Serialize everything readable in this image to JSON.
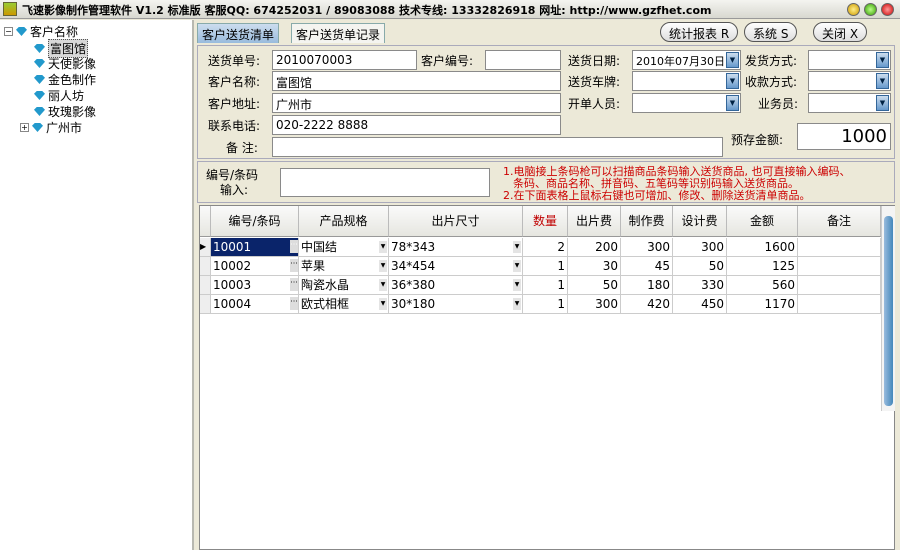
{
  "title": "飞速影像制作管理软件 V1.2 标准版 客服QQ: 674252031 / 89083088  技术专线: 13332826918 网址: http://www.gzfhet.com",
  "tree": {
    "root": "客户名称",
    "items": [
      "富图馆",
      "天使影像",
      "金色制作",
      "丽人坊",
      "玫瑰影像",
      "广州市"
    ]
  },
  "tabs": [
    "客户送货清单",
    "客户送货单记录"
  ],
  "buttons": {
    "report": "统计报表 R",
    "system": "系统 S",
    "close": "关闭 X"
  },
  "form": {
    "order_no_label": "送货单号:",
    "order_no": "2010070003",
    "cust_no_label": "客户编号:",
    "cust_no": "",
    "cust_name_label": "客户名称:",
    "cust_name": "富图馆",
    "address_label": "客户地址:",
    "address": "广州市",
    "phone_label": "联系电话:",
    "phone": "020-2222 8888",
    "note_label": "备  注:",
    "note": "",
    "date_label": "送货日期:",
    "date": "2010年07月30日",
    "plate_label": "送货车牌:",
    "plate": "",
    "issuer_label": "开单人员:",
    "issuer": "",
    "ship_label": "发货方式:",
    "ship": "",
    "pay_label": "收款方式:",
    "pay": "",
    "sales_label": "业务员:",
    "sales": "",
    "deposit_label": "预存金额:",
    "deposit": "1000"
  },
  "barcode": {
    "label1": "编号/条码",
    "label2": "输入:",
    "value": "",
    "hint1": "1.电脑接上条码枪可以扫描商品条码输入送货商品, 也可直接输入编码、",
    "hint2": "条码、商品名称、拼音码、五笔码等识别码输入送货商品。",
    "hint3": "2.在下面表格上鼠标右键也可增加、修改、删除送货清单商品。"
  },
  "grid": {
    "columns": [
      "编号/条码",
      "产品规格",
      "出片尺寸",
      "数量",
      "出片费",
      "制作费",
      "设计费",
      "金额",
      "备注"
    ],
    "rows": [
      [
        "10001",
        "中国结",
        "78*343",
        "2",
        "200",
        "300",
        "300",
        "1600",
        ""
      ],
      [
        "10002",
        "苹果",
        "34*454",
        "1",
        "30",
        "45",
        "50",
        "125",
        ""
      ],
      [
        "10003",
        "陶瓷水晶",
        "36*380",
        "1",
        "50",
        "180",
        "330",
        "560",
        ""
      ],
      [
        "10004",
        "欧式相框",
        "30*180",
        "1",
        "300",
        "420",
        "450",
        "1170",
        ""
      ]
    ]
  },
  "colors": {
    "qty_header": "#c00000",
    "hint": "#cc0000",
    "selected": "#0a246a"
  }
}
